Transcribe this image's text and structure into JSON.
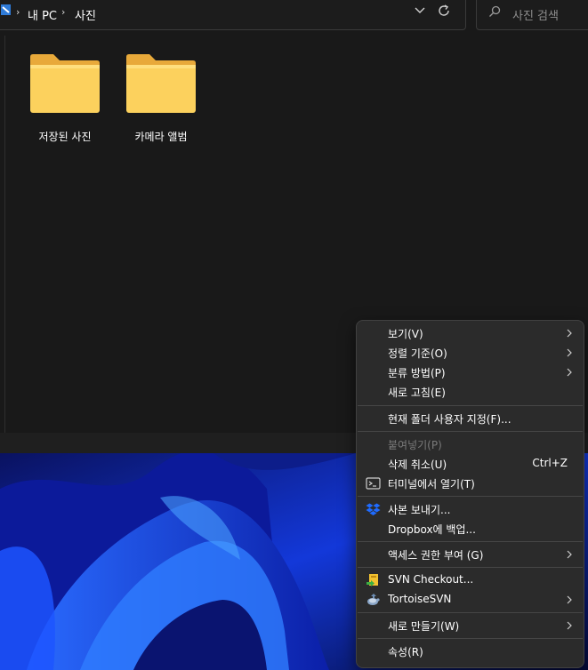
{
  "address_bar": {
    "crumbs": [
      "내 PC",
      "사진"
    ],
    "separator": "›"
  },
  "search": {
    "placeholder": "사진 검색"
  },
  "folders": [
    {
      "label": "저장된 사진",
      "icon": "folder-icon"
    },
    {
      "label": "카메라 앨범",
      "icon": "folder-icon"
    }
  ],
  "context_menu": {
    "items": [
      {
        "label": "보기(V)",
        "submenu": true
      },
      {
        "label": "정렬 기준(O)",
        "submenu": true
      },
      {
        "label": "분류 방법(P)",
        "submenu": true
      },
      {
        "label": "새로 고침(E)"
      },
      {
        "label": "현재 폴더 사용자 지정(F)..."
      },
      {
        "label": "붙여넣기(P)",
        "disabled": true
      },
      {
        "label": "삭제 취소(U)",
        "shortcut": "Ctrl+Z"
      },
      {
        "label": "터미널에서 열기(T)",
        "icon": "terminal-icon"
      },
      {
        "label": "사본 보내기...",
        "icon": "dropbox-icon"
      },
      {
        "label": "Dropbox에 백업..."
      },
      {
        "label": "액세스 권한 부여 (G)",
        "submenu": true
      },
      {
        "label": "SVN Checkout...",
        "icon": "svn-checkout-icon"
      },
      {
        "label": "TortoiseSVN",
        "icon": "tortoisesvn-icon",
        "submenu": true
      },
      {
        "label": "새로 만들기(W)",
        "submenu": true
      },
      {
        "label": "속성(R)"
      }
    ]
  },
  "colors": {
    "window_bg": "#191919",
    "menu_bg": "#2b2b2b",
    "folder_yellow": "#fcd15d",
    "wallpaper_blue": "#1f4cff"
  }
}
